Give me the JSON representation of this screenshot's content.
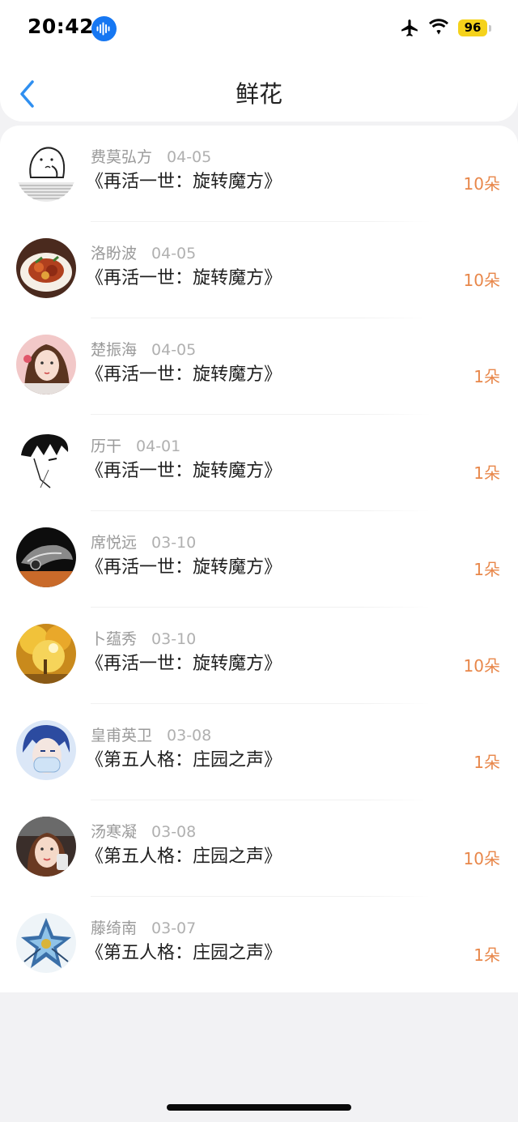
{
  "status_bar": {
    "time": "20:42",
    "battery": "96"
  },
  "header": {
    "title": "鲜花"
  },
  "items": [
    {
      "name": "费莫弘方",
      "date": "04-05",
      "book": "《再活一世：旋转魔方》",
      "count": "10朵",
      "avatar": "meme-avatar"
    },
    {
      "name": "洛盼波",
      "date": "04-05",
      "book": "《再活一世：旋转魔方》",
      "count": "10朵",
      "avatar": "food-avatar"
    },
    {
      "name": "楚振海",
      "date": "04-05",
      "book": "《再活一世：旋转魔方》",
      "count": "1朵",
      "avatar": "girl-avatar"
    },
    {
      "name": "历干",
      "date": "04-01",
      "book": "《再活一世：旋转魔方》",
      "count": "1朵",
      "avatar": "anime-sketch-avatar"
    },
    {
      "name": "席悦远",
      "date": "03-10",
      "book": "《再活一世：旋转魔方》",
      "count": "1朵",
      "avatar": "car-avatar"
    },
    {
      "name": "卜蕴秀",
      "date": "03-10",
      "book": "《再活一世：旋转魔方》",
      "count": "10朵",
      "avatar": "autumn-tree-avatar"
    },
    {
      "name": "皇甫英卫",
      "date": "03-08",
      "book": "《第五人格：庄园之声》",
      "count": "1朵",
      "avatar": "anime-mask-avatar"
    },
    {
      "name": "汤寒凝",
      "date": "03-08",
      "book": "《第五人格：庄园之声》",
      "count": "10朵",
      "avatar": "selfie-avatar"
    },
    {
      "name": "藤绮南",
      "date": "03-07",
      "book": "《第五人格：庄园之声》",
      "count": "1朵",
      "avatar": "game-character-avatar"
    }
  ],
  "colors": {
    "accent_blue": "#2f8ff0",
    "flower_orange": "#e8874a",
    "battery_yellow": "#f5d21b",
    "voice_blue": "#1677f2"
  }
}
